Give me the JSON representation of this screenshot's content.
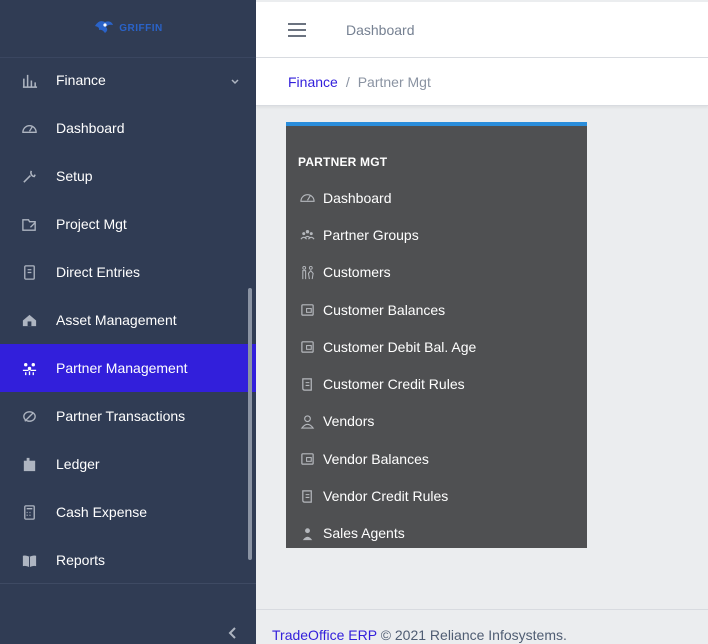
{
  "brand": {
    "logo_text": "GRIFFIN",
    "logo_icon": "griffin-logo-icon"
  },
  "header": {
    "title": "Dashboard",
    "menu_icon": "hamburger-icon"
  },
  "breadcrumb": {
    "parent": "Finance",
    "separator": "/",
    "current": "Partner Mgt"
  },
  "sidebar": {
    "items": [
      {
        "label": "Finance",
        "icon": "chart-icon",
        "has_dropdown": true
      },
      {
        "label": "Dashboard",
        "icon": "speedometer-icon"
      },
      {
        "label": "Setup",
        "icon": "wrench-icon"
      },
      {
        "label": "Project Mgt",
        "icon": "folder-edit-icon"
      },
      {
        "label": "Direct Entries",
        "icon": "notebook-icon"
      },
      {
        "label": "Asset Management",
        "icon": "home-icon"
      },
      {
        "label": "Partner Management",
        "icon": "people-icon",
        "active": true
      },
      {
        "label": "Partner Transactions",
        "icon": "leaf-icon"
      },
      {
        "label": "Ledger",
        "icon": "ledger-icon"
      },
      {
        "label": "Cash Expense",
        "icon": "calculator-icon"
      },
      {
        "label": "Reports",
        "icon": "book-icon"
      }
    ],
    "collapse_icon": "chevron-left-icon"
  },
  "panel": {
    "title": "PARTNER MGT",
    "accent_color": "#2a8ddb",
    "items": [
      {
        "label": "Dashboard",
        "icon": "speedometer-icon"
      },
      {
        "label": "Partner Groups",
        "icon": "group-icon"
      },
      {
        "label": "Customers",
        "icon": "couple-icon"
      },
      {
        "label": "Customer Balances",
        "icon": "wallet-icon"
      },
      {
        "label": "Customer Debit Bal. Age",
        "icon": "wallet-icon"
      },
      {
        "label": "Customer Credit Rules",
        "icon": "document-icon"
      },
      {
        "label": "Vendors",
        "icon": "person-outline-icon"
      },
      {
        "label": "Vendor Balances",
        "icon": "wallet-icon"
      },
      {
        "label": "Vendor Credit Rules",
        "icon": "document-icon"
      },
      {
        "label": "Sales Agents",
        "icon": "agent-icon"
      }
    ]
  },
  "footer": {
    "link_text": "TradeOffice ERP",
    "copyright": "© 2021 Reliance Infosystems."
  },
  "colors": {
    "sidebar_bg": "#303c54",
    "active_bg": "#321fdb",
    "panel_bg": "#4f5052",
    "link": "#321fdb"
  }
}
